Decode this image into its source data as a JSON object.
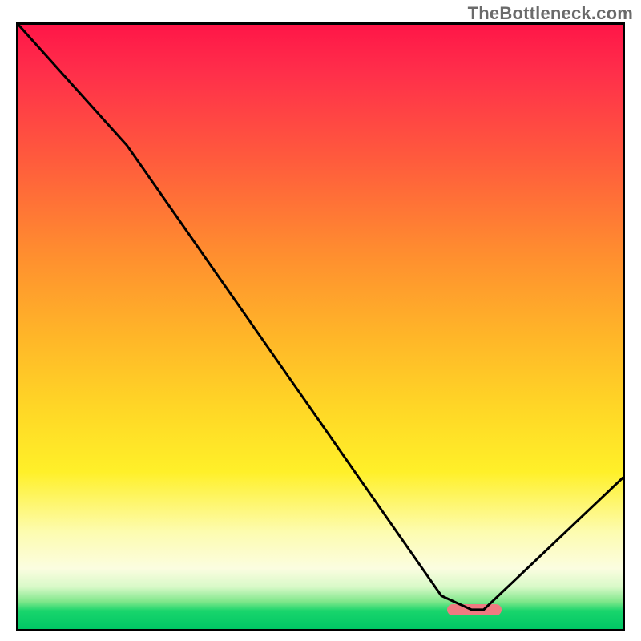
{
  "watermark": "TheBottleneck.com",
  "chart_data": {
    "type": "line",
    "title": "",
    "xlabel": "",
    "ylabel": "",
    "xlim": [
      0,
      100
    ],
    "ylim": [
      0,
      100
    ],
    "grid": false,
    "legend": false,
    "series": [
      {
        "name": "bottleneck-curve",
        "x": [
          0,
          18,
          70,
          75,
          77,
          100
        ],
        "values": [
          100,
          80,
          5.5,
          3.2,
          3.2,
          25
        ]
      }
    ],
    "annotations": [
      {
        "name": "optimum-pill",
        "shape": "rounded-rect",
        "color": "#f07a81",
        "x_range": [
          71,
          80
        ],
        "y": 3.2
      }
    ],
    "background": {
      "type": "vertical-gradient",
      "stops": [
        {
          "pos": 0,
          "color": "#ff1648"
        },
        {
          "pos": 22,
          "color": "#ff5a3d"
        },
        {
          "pos": 52,
          "color": "#ffb728"
        },
        {
          "pos": 74,
          "color": "#fff029"
        },
        {
          "pos": 90,
          "color": "#fbfde0"
        },
        {
          "pos": 100,
          "color": "#00c765"
        }
      ]
    }
  }
}
